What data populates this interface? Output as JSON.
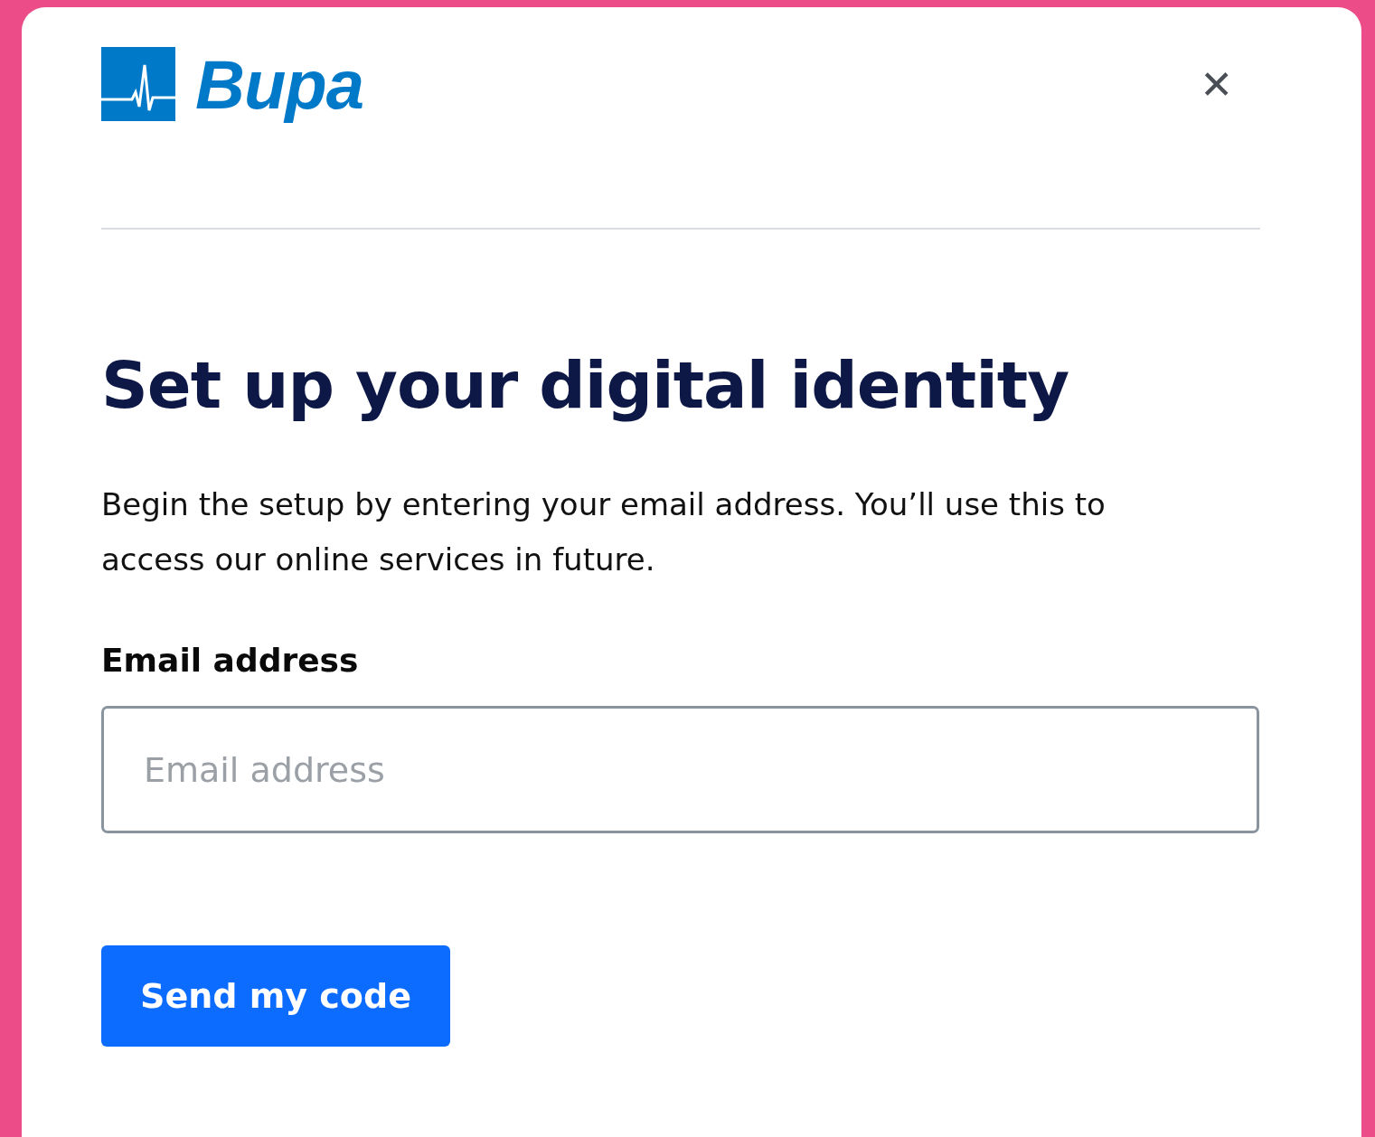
{
  "header": {
    "logo_text": "Bupa",
    "close_label": "✕"
  },
  "title": "Set up your digital identity",
  "description": "Begin the setup by entering your email address. You’ll use this to access our online services in future.",
  "email_field": {
    "label": "Email address",
    "placeholder": "Email address"
  },
  "submit_button": "Send my code"
}
